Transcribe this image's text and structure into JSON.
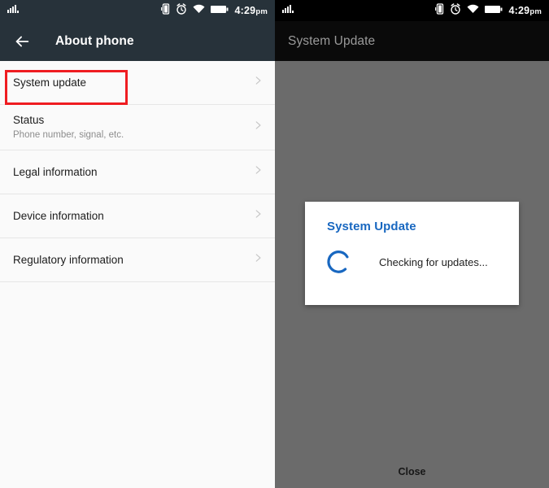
{
  "left_phone": {
    "status_bar": {
      "signal_icon": "signal-bars-icon",
      "icons": [
        "vibrate-icon",
        "alarm-clock-icon",
        "wifi-icon",
        "battery-icon"
      ],
      "time": "4:29",
      "ampm": "pm"
    },
    "toolbar": {
      "back_icon": "back-arrow-icon",
      "title": "About phone"
    },
    "list": [
      {
        "title": "System update",
        "subtitle": "",
        "chevron": "chevron-right-icon",
        "highlighted": true
      },
      {
        "title": "Status",
        "subtitle": "Phone number, signal, etc.",
        "chevron": "chevron-right-icon",
        "highlighted": false
      },
      {
        "title": "Legal information",
        "subtitle": "",
        "chevron": "chevron-right-icon",
        "highlighted": false
      },
      {
        "title": "Device information",
        "subtitle": "",
        "chevron": "chevron-right-icon",
        "highlighted": false
      },
      {
        "title": "Regulatory information",
        "subtitle": "",
        "chevron": "chevron-right-icon",
        "highlighted": false
      }
    ],
    "highlight_color": "#ef1c21"
  },
  "right_phone": {
    "status_bar": {
      "signal_icon": "signal-bars-icon",
      "icons": [
        "vibrate-icon",
        "alarm-clock-icon",
        "wifi-icon",
        "battery-icon"
      ],
      "time": "4:29",
      "ampm": "pm"
    },
    "toolbar": {
      "title": "System Update"
    },
    "dialog": {
      "title": "System Update",
      "spinner_icon": "loading-spinner-icon",
      "message": "Checking for updates...",
      "accent_color": "#1867c0"
    },
    "close_label": "Close"
  }
}
